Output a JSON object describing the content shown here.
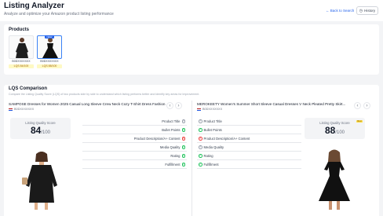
{
  "header": {
    "title": "Listing Analyzer",
    "subtitle": "Analyze and optimize your Amazon product listing performance",
    "back_link": "← Back to Search",
    "history_label": "History"
  },
  "products": {
    "section_title": "Products",
    "items": [
      {
        "sku": "B0DXXXXXXX",
        "score": "LQS 84/100",
        "selected": false
      },
      {
        "sku": "B0DXXXXXXX",
        "score": "LQS 88/100",
        "selected": true,
        "tag": "NEW"
      }
    ]
  },
  "comparison": {
    "section_title": "LQS Comparison",
    "description": "Compare the Listing Quality Score (LQS) of two products side by side to understand which listing performs better and identify key areas for improvement.",
    "left": {
      "title": "SAMPOSE Dresses for Women 2025 Casual Long Sleeve Crew Neck Cozy T-Shirt Dress Fashion...",
      "asin": "B0DXXXXXXX",
      "score_label": "Listing Quality Score",
      "score": "84",
      "score_den": "/100"
    },
    "right": {
      "title": "MEROKEETY Women's Summer Short Sleeve Casual Dresses V Neck Pleated Pretty Skirt...",
      "asin": "B0DXXXXXXX",
      "score_label": "Listing Quality Score",
      "score": "88",
      "score_den": "/100",
      "badge": "Best"
    },
    "criteria": [
      "Product Title",
      "Bullet Points",
      "Product Description/A+ Content",
      "Media Quality",
      "Rating",
      "Fulfillment"
    ],
    "left_status": [
      "q",
      "ok",
      "bad",
      "ok",
      "ok",
      "ok"
    ],
    "right_status": [
      "q",
      "ok",
      "bad",
      "q",
      "ok",
      "ok"
    ]
  }
}
